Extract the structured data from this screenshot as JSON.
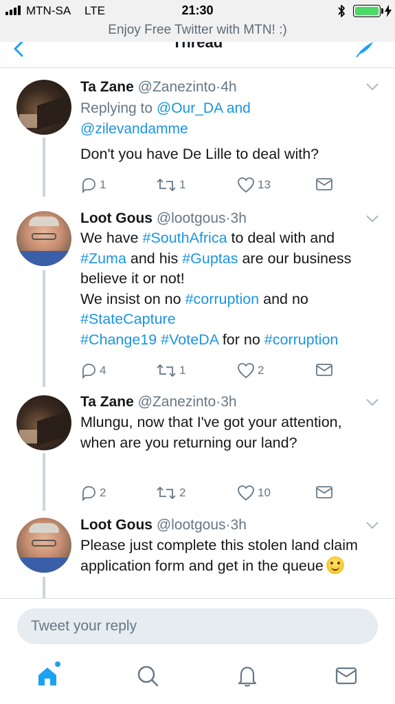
{
  "status_bar": {
    "carrier": "MTN-SA",
    "network": "LTE",
    "time": "21:30",
    "battery_level": 1.0
  },
  "promo_banner": "Enjoy Free Twitter with MTN! :)",
  "header": {
    "title": "Thread",
    "back_icon": "chevron-left-icon",
    "compose_icon": "compose-icon"
  },
  "tweets": [
    {
      "name": "Ta Zane",
      "handle": "@Zanezinto",
      "dot": "·",
      "time": "4h",
      "replying_prefix": "Replying to",
      "replying_to_1": "@Our_DA",
      "replying_and": "and",
      "replying_to_2": "@zilevandamme",
      "text": "Don't you have De Lille to deal with?",
      "replies": "1",
      "retweets": "1",
      "likes": "13"
    },
    {
      "name": "Loot Gous",
      "handle": "@lootgous",
      "dot": "·",
      "time": "3h",
      "segments": [
        "We have ",
        "#SouthAfrica",
        " to deal with and ",
        "#Zuma",
        " and his ",
        "#Guptas",
        " are our business believe it or not!",
        "We insist on no ",
        "#corruption",
        " and no",
        "#StateCapture",
        "#Change19",
        " ",
        "#VoteDA",
        " for no ",
        "#corruption"
      ],
      "replies": "4",
      "retweets": "1",
      "likes": "2"
    },
    {
      "name": "Ta Zane",
      "handle": "@Zanezinto",
      "dot": "·",
      "time": "3h",
      "text": "Mlungu, now that I've got your attention, when are you returning our land?",
      "replies": "2",
      "retweets": "2",
      "likes": "10"
    },
    {
      "name": "Loot Gous",
      "handle": "@lootgous",
      "dot": "·",
      "time": "3h",
      "text": "Please just complete this stolen land claim application form and get in the queue",
      "emoji": "smiling-face-emoji"
    }
  ],
  "reply_bar": {
    "placeholder": "Tweet your reply"
  },
  "tab_bar": {
    "items": [
      "home-icon",
      "search-icon",
      "notifications-bell-icon",
      "messages-envelope-icon"
    ],
    "active": "home-icon"
  },
  "colors": {
    "link": "#1b95e0",
    "secondary_text": "#657786",
    "primary_text": "#14171a",
    "accent": "#1da1f2",
    "battery": "#4cd964"
  }
}
